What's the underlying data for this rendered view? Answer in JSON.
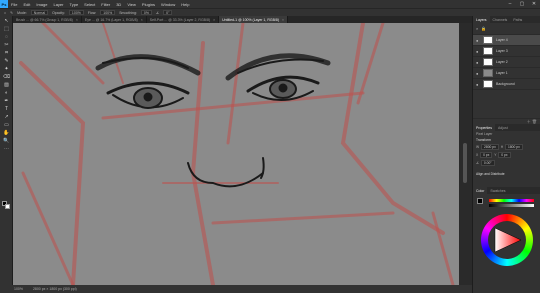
{
  "app": {
    "logo": "Ps"
  },
  "menu": [
    "File",
    "Edit",
    "Image",
    "Layer",
    "Type",
    "Select",
    "Filter",
    "3D",
    "View",
    "Plugins",
    "Window",
    "Help"
  ],
  "window_controls": [
    "–",
    "▢",
    "✕"
  ],
  "options": {
    "mode_label": "Mode:",
    "mode": "Normal",
    "opacity_label": "Opacity:",
    "opacity": "100%",
    "flow_label": "Flow:",
    "flow": "100%",
    "smoothing_label": "Smoothing:",
    "smoothing": "0%",
    "angle": "0°"
  },
  "tabs": [
    {
      "label": "Brush ... @ 66.7% (Group 1, RGB/8)",
      "active": false
    },
    {
      "label": "Eye ... @ 16.7% (Layer 1, RGB/8)",
      "active": false
    },
    {
      "label": "Self-Port ... @ 33.3% (Layer 2, RGB/8)",
      "active": false
    },
    {
      "label": "Untitled-1 @ 100% (Layer 1, RGB/8)",
      "active": true
    }
  ],
  "tools": [
    "↖",
    "⬚",
    "◌",
    "✂",
    "⌗",
    "✎",
    "✦",
    "⌫",
    "▨",
    "◐",
    "✒",
    "T",
    "↗",
    "▭",
    "✋",
    "🔍",
    "⋯"
  ],
  "status": {
    "zoom": "100%",
    "doc": "2800 px × 1800 px (300 ppi)"
  },
  "layers_panel": {
    "tabs": [
      {
        "label": "Layers",
        "on": true
      },
      {
        "label": "Channels",
        "on": false
      },
      {
        "label": "Paths",
        "on": false
      }
    ],
    "layers": [
      {
        "name": "Layer 4",
        "sel": true,
        "thumb": "white"
      },
      {
        "name": "Layer 3",
        "sel": false,
        "thumb": "white"
      },
      {
        "name": "Layer 2",
        "sel": false,
        "thumb": "white"
      },
      {
        "name": "Layer 1",
        "sel": false,
        "thumb": "gray"
      },
      {
        "name": "Background",
        "sel": false,
        "thumb": "white"
      }
    ]
  },
  "properties_panel": {
    "tabs": [
      {
        "label": "Properties",
        "on": true
      },
      {
        "label": "Adjust",
        "on": false
      }
    ],
    "type": "Pixel Layer",
    "section": "Transform",
    "w_label": "W",
    "w": "2800 px",
    "h_label": "H",
    "h": "1800 px",
    "x_label": "X",
    "x": "0 px",
    "y_label": "Y",
    "y": "0 px",
    "angle": "0.00°",
    "align_section": "Align and Distribute"
  },
  "color_panel": {
    "tabs": [
      {
        "label": "Color",
        "on": true
      },
      {
        "label": "Swatches",
        "on": false
      }
    ],
    "fg": "#000000",
    "bg": "#ffffff"
  },
  "colors": {
    "canvas": "#8b8b8b",
    "sketch_red": "#c0504d",
    "ink": "#1a1a1a"
  }
}
